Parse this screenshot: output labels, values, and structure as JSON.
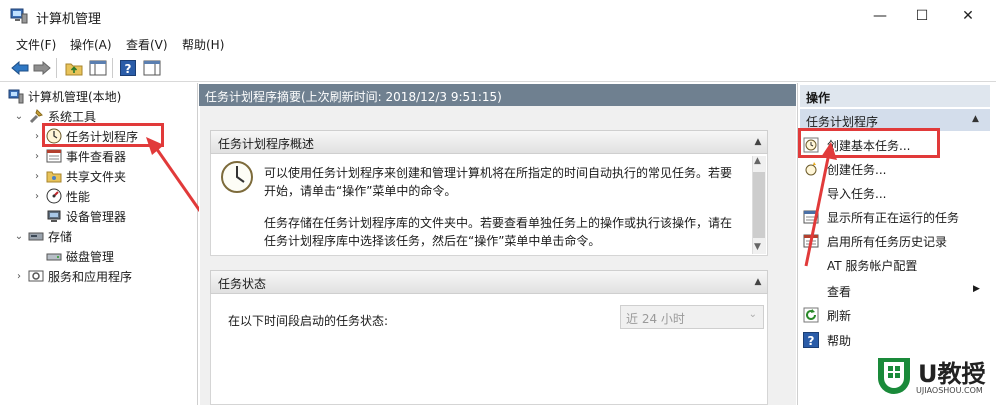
{
  "window": {
    "title": "计算机管理",
    "minimize": "—",
    "maximize": "☐",
    "close": "✕"
  },
  "menu": [
    "文件(F)",
    "操作(A)",
    "查看(V)",
    "帮助(H)"
  ],
  "tree": {
    "root": "计算机管理(本地)",
    "items": [
      {
        "label": "系统工具",
        "level": 1,
        "expanded": true
      },
      {
        "label": "任务计划程序",
        "level": 2,
        "selected": true
      },
      {
        "label": "事件查看器",
        "level": 2
      },
      {
        "label": "共享文件夹",
        "level": 2
      },
      {
        "label": "性能",
        "level": 2
      },
      {
        "label": "设备管理器",
        "level": 2
      },
      {
        "label": "存储",
        "level": 1,
        "expanded": true
      },
      {
        "label": "磁盘管理",
        "level": 2
      },
      {
        "label": "服务和应用程序",
        "level": 1
      }
    ]
  },
  "center": {
    "header": "任务计划程序摘要(上次刷新时间: 2018/12/3 9:51:15)",
    "overview": {
      "title": "任务计划程序概述",
      "line1": "可以使用任务计划程序来创建和管理计算机将在所指定的时间自动执行的常见任务。若要",
      "line2": "开始，请单击“操作”菜单中的命令。",
      "line3": "任务存储在任务计划程序库的文件夹中。若要查看单独任务上的操作或执行该操作，请在",
      "line4": "任务计划程序库中选择该任务，然后在“操作”菜单中单击命令。"
    },
    "status": {
      "title": "任务状态",
      "label": "在以下时间段启动的任务状态:",
      "select_value": "近 24 小时"
    }
  },
  "actions": {
    "title": "操作",
    "group": "任务计划程序",
    "items": [
      "创建基本任务...",
      "创建任务...",
      "导入任务...",
      "显示所有正在运行的任务",
      "启用所有任务历史记录",
      "AT 服务帐户配置",
      "查看",
      "刷新",
      "帮助"
    ]
  },
  "watermark": {
    "brand": "U教授",
    "domain": "UJIAOSHOU.COM"
  },
  "colors": {
    "highlight": "#e13a3a",
    "header_bg": "#6f8090",
    "action_group_bg": "#d3ddeb"
  }
}
